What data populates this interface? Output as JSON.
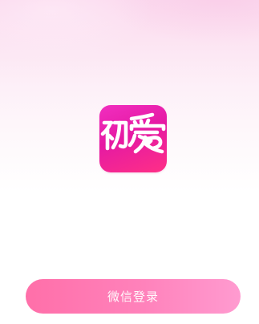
{
  "app": {
    "logo_text": "初爱",
    "logo_colors": {
      "top": "#f12ec0",
      "bottom": "#ff2f86",
      "glyph": "#ffffff"
    }
  },
  "login": {
    "wechat_button_label": "微信登录",
    "button_color_start": "#ff6fa9",
    "button_color_end": "#ff9bd0"
  }
}
